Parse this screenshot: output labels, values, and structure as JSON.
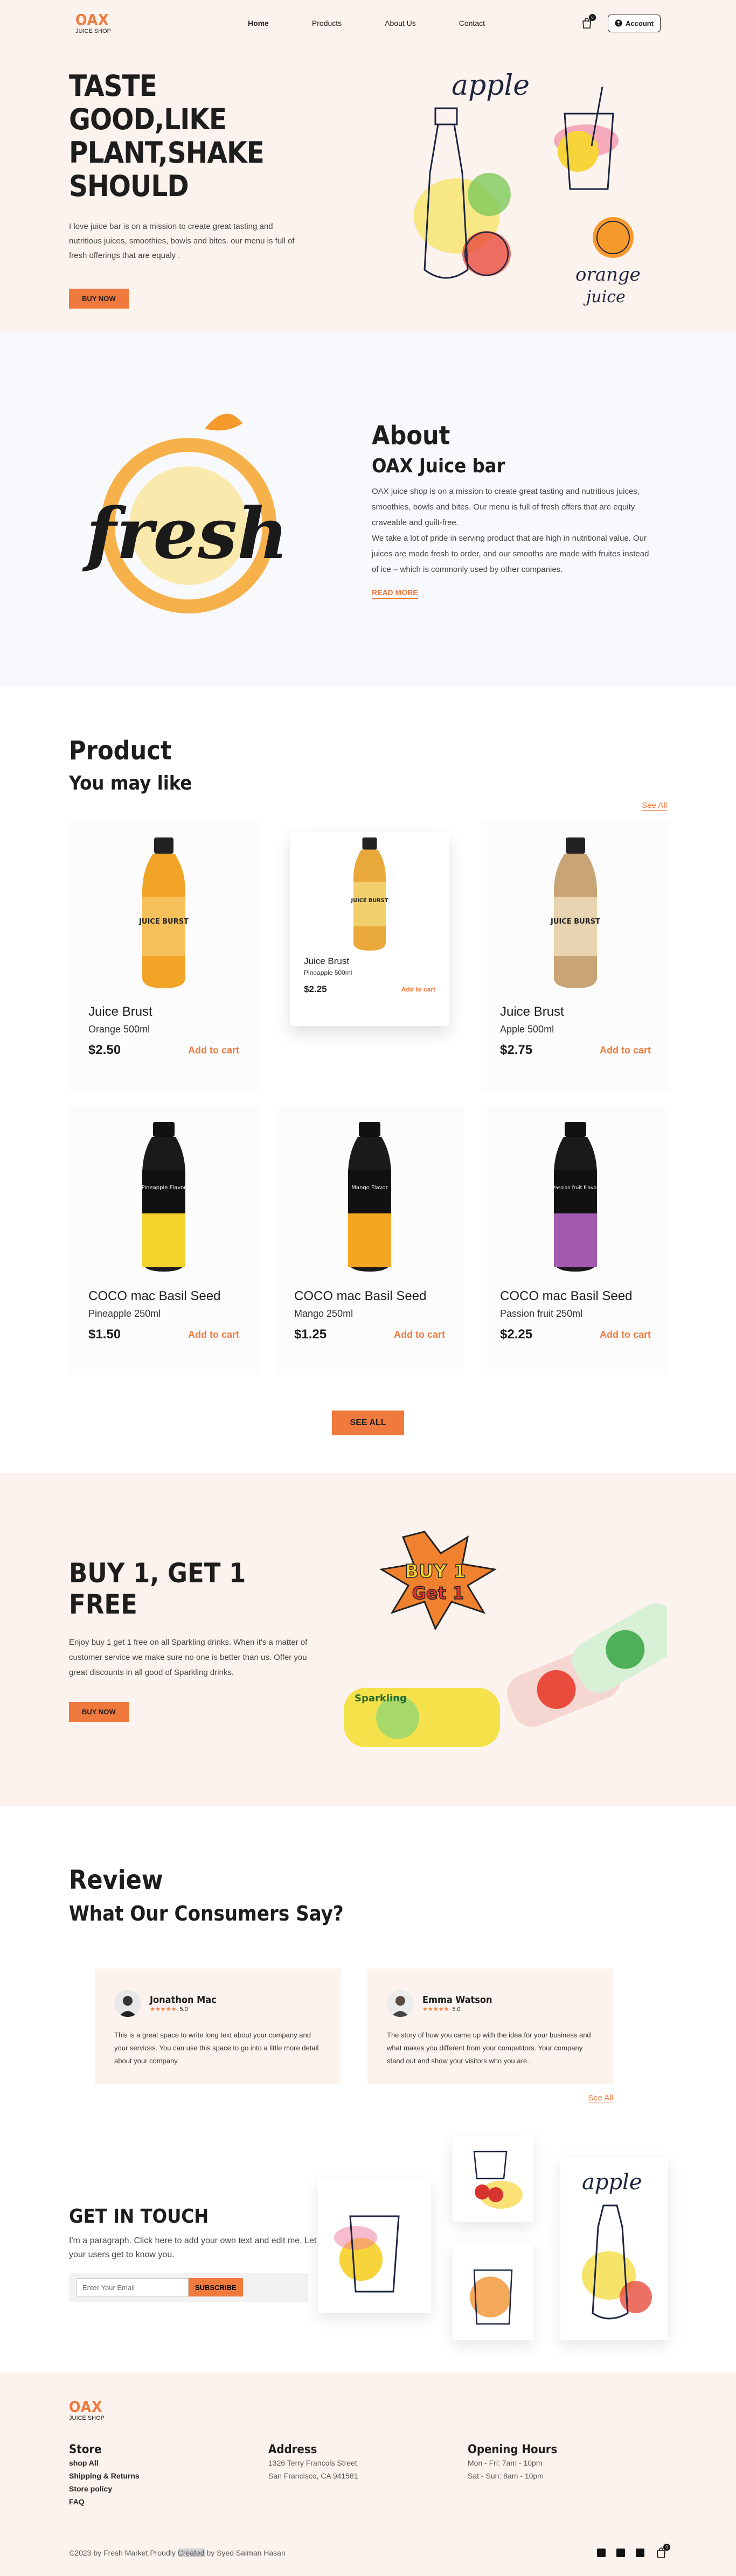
{
  "header": {
    "logo_brand": "OAX",
    "logo_sub": "JUICE SHOP",
    "nav": [
      "Home",
      "Products",
      "About Us",
      "Contact"
    ],
    "cart_count": "0",
    "account_label": "Account"
  },
  "hero": {
    "title_line1": "TASTE GOOD,LIKE",
    "title_line2": "PLANT,SHAKE SHOULD",
    "text": "I love juice bar is on a mission to create great tasting and nutritious juices, smoothies, bowls and bites. our menu is full of fresh offerings that are equaly .",
    "button": "BUY NOW",
    "art_word1": "apple",
    "art_word2": "orange",
    "art_word3": "juice"
  },
  "about": {
    "title": "About",
    "subtitle": "OAX Juice bar",
    "para1": "OAX juice shop is on a mission to create great tasting and nutritious juices, smoothies, bowls and bites. Our menu is full of fresh offers that are equity craveable and guilt-free.",
    "para2": "We take a lot of pride in serving product that are high in nutritional value. Our juices are made fresh to order, and our smooths are made with fruites instead of ice – which is commonly used by other companies.",
    "read_more": "READ MORE",
    "art_word": "fresh"
  },
  "products": {
    "title": "Product",
    "subtitle": "You may like",
    "see_all_link": "See All",
    "add_label": "Add to cart",
    "see_all_button": "SEE ALL",
    "items": [
      {
        "name": "Juice Brust",
        "variant": "Orange 500ml",
        "price": "$2.50",
        "bottle_label": "JUICE BURST"
      },
      {
        "name": "Juice Brust",
        "variant": "Pineapple 500ml",
        "price": "$2.25",
        "bottle_label": "JUICE BURST"
      },
      {
        "name": "Juice Brust",
        "variant": "Apple 500ml",
        "price": "$2.75",
        "bottle_label": "JUICE BURST"
      },
      {
        "name": "COCO mac Basil Seed",
        "variant": "Pineapple 250ml",
        "price": "$1.50",
        "bottle_label": "Pineapple Flavor"
      },
      {
        "name": "COCO mac Basil Seed",
        "variant": "Mango 250ml",
        "price": "$1.25",
        "bottle_label": "Mango Flavor"
      },
      {
        "name": "COCO mac Basil Seed",
        "variant": "Passion fruit 250ml",
        "price": "$2.25",
        "bottle_label": "Passion fruit Flavor"
      }
    ]
  },
  "promo": {
    "title": "BUY 1, GET 1 FREE",
    "text": "Enjoy buy 1 get 1 free on all Sparkling drinks. When it's a matter of customer service we make sure no one is better than us. Offer you great discounts in all good of Sparkling drinks.",
    "button": "BUY NOW",
    "badge_line1": "BUY 1",
    "badge_line2": "Get 1",
    "can_label": "Sparkling"
  },
  "reviews": {
    "title": "Review",
    "subtitle": "What Our Consumers Say?",
    "see_all": "See All",
    "items": [
      {
        "name": "Jonathon Mac",
        "rating": "5.0",
        "stars": "★★★★★",
        "text": "This is a great space to write long text about your company and your services. You can use this space to go into a little more detail about your company."
      },
      {
        "name": "Emma Watson",
        "rating": "5.0",
        "stars": "★★★★★",
        "text": "The story of how you came up with the idea for your business and what makes you different from your competitors. Your company stand out and show your visitors who you are.."
      }
    ]
  },
  "contact": {
    "title": "GET IN TOUCH",
    "text": "I'm a paragraph. Click here to add your own text and edit me. Let your users get to know you.",
    "email_placeholder": "Enter Your Email",
    "button": "SUBSCRIBE",
    "art_word": "apple"
  },
  "footer": {
    "logo_brand": "OAX",
    "logo_sub": "JUICE SHOP",
    "store_title": "Store",
    "store_links": [
      "shop All",
      "Shipping & Returns",
      "Store policy",
      "FAQ"
    ],
    "address_title": "Address",
    "address_line1": "1326 Terry Francois Street",
    "address_line2": "San Francisco, CA 941581",
    "hours_title": "Opening Hours",
    "hours_line1": "Mon - Fri: 7am - 10pm",
    "hours_line2": "Sat - Sun: 8am - 10pm",
    "copy_prefix": "©2023 by Fresh Market.Proudly",
    "copy_highlight": "Created",
    "copy_suffix": "by Syed Salman Hasan",
    "cart_count": "0"
  },
  "colors": {
    "accent": "#f07a3e",
    "peach_bg": "#fdf3ee",
    "light_bg": "#f8f9fc"
  }
}
